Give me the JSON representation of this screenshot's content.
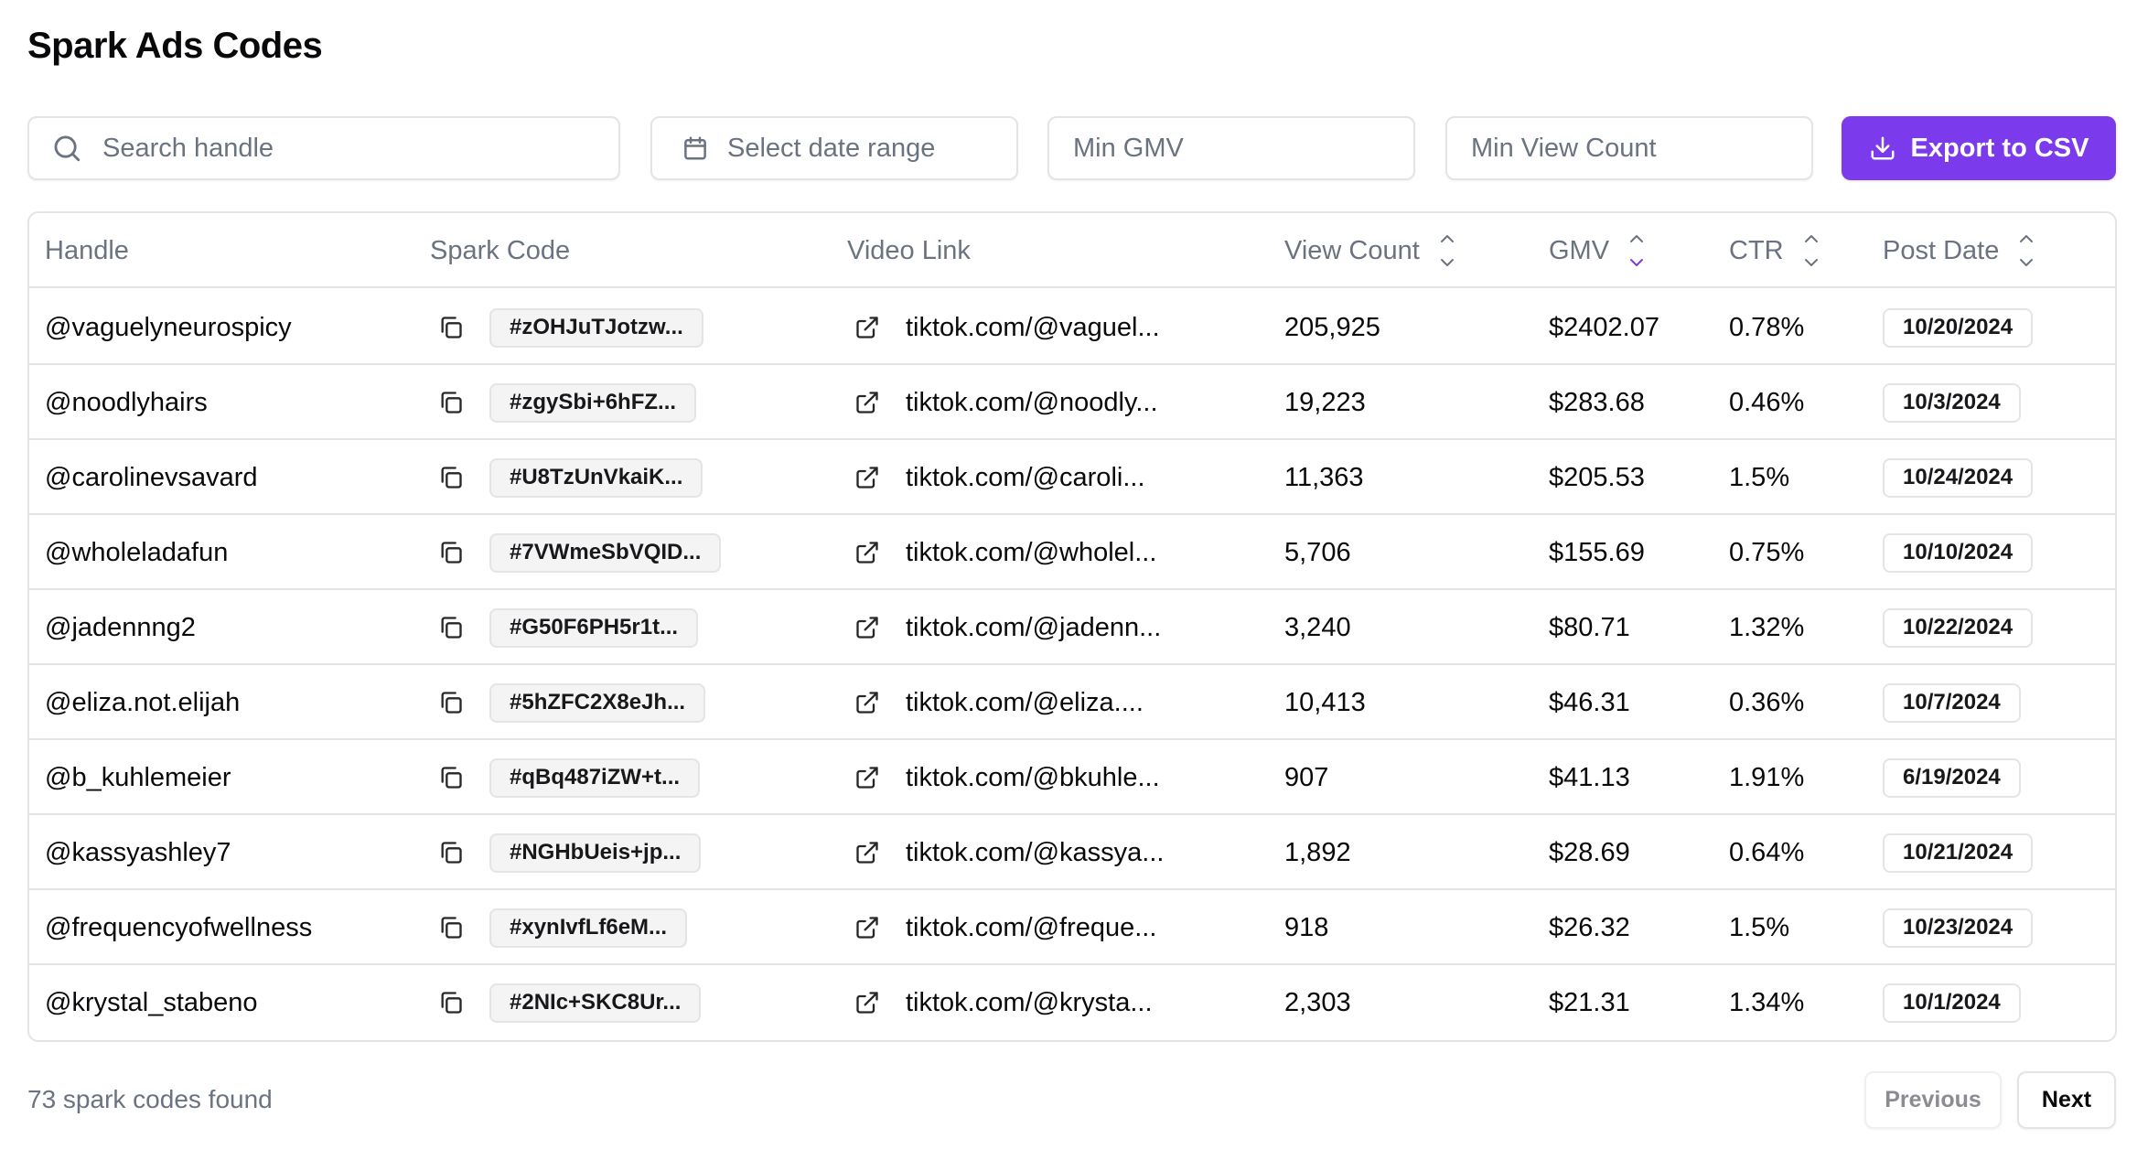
{
  "page": {
    "title": "Spark Ads Codes"
  },
  "filters": {
    "search_placeholder": "Search handle",
    "search_icon": "search-icon",
    "date_placeholder": "Select date range",
    "date_icon": "calendar-icon",
    "min_gmv_placeholder": "Min GMV",
    "min_view_placeholder": "Min View Count",
    "export_label": "Export to CSV",
    "export_icon": "download-icon"
  },
  "colors": {
    "accent": "#7c3aed",
    "border": "#e4e4e7",
    "muted_text": "#6b7280",
    "text": "#09090b",
    "chip_bg": "#f4f4f5"
  },
  "table": {
    "columns": [
      {
        "label": "Handle",
        "sortable": false
      },
      {
        "label": "Spark Code",
        "sortable": false
      },
      {
        "label": "Video Link",
        "sortable": false
      },
      {
        "label": "View Count",
        "sortable": true,
        "sort": "none"
      },
      {
        "label": "GMV",
        "sortable": true,
        "sort": "desc"
      },
      {
        "label": "CTR",
        "sortable": true,
        "sort": "none"
      },
      {
        "label": "Post Date",
        "sortable": true,
        "sort": "none"
      }
    ],
    "rows": [
      {
        "handle": "@vaguelyneurospicy",
        "spark_code": "#zOHJuTJotzw...",
        "video_link": "tiktok.com/@vaguel...",
        "views": "205,925",
        "gmv": "$2402.07",
        "ctr": "0.78%",
        "post_date": "10/20/2024"
      },
      {
        "handle": "@noodlyhairs",
        "spark_code": "#zgySbi+6hFZ...",
        "video_link": "tiktok.com/@noodly...",
        "views": "19,223",
        "gmv": "$283.68",
        "ctr": "0.46%",
        "post_date": "10/3/2024"
      },
      {
        "handle": "@carolinevsavard",
        "spark_code": "#U8TzUnVkaiK...",
        "video_link": "tiktok.com/@caroli...",
        "views": "11,363",
        "gmv": "$205.53",
        "ctr": "1.5%",
        "post_date": "10/24/2024"
      },
      {
        "handle": "@wholeladafun",
        "spark_code": "#7VWmeSbVQID...",
        "video_link": "tiktok.com/@wholel...",
        "views": "5,706",
        "gmv": "$155.69",
        "ctr": "0.75%",
        "post_date": "10/10/2024"
      },
      {
        "handle": "@jadennng2",
        "spark_code": "#G50F6PH5r1t...",
        "video_link": "tiktok.com/@jadenn...",
        "views": "3,240",
        "gmv": "$80.71",
        "ctr": "1.32%",
        "post_date": "10/22/2024"
      },
      {
        "handle": "@eliza.not.elijah",
        "spark_code": "#5hZFC2X8eJh...",
        "video_link": "tiktok.com/@eliza....",
        "views": "10,413",
        "gmv": "$46.31",
        "ctr": "0.36%",
        "post_date": "10/7/2024"
      },
      {
        "handle": "@b_kuhlemeier",
        "spark_code": "#qBq487iZW+t...",
        "video_link": "tiktok.com/@bkuhle...",
        "views": "907",
        "gmv": "$41.13",
        "ctr": "1.91%",
        "post_date": "6/19/2024"
      },
      {
        "handle": "@kassyashley7",
        "spark_code": "#NGHbUeis+jp...",
        "video_link": "tiktok.com/@kassya...",
        "views": "1,892",
        "gmv": "$28.69",
        "ctr": "0.64%",
        "post_date": "10/21/2024"
      },
      {
        "handle": "@frequencyofwellness",
        "spark_code": "#xynIvfLf6eM...",
        "video_link": "tiktok.com/@freque...",
        "views": "918",
        "gmv": "$26.32",
        "ctr": "1.5%",
        "post_date": "10/23/2024"
      },
      {
        "handle": "@krystal_stabeno",
        "spark_code": "#2NIc+SKC8Ur...",
        "video_link": "tiktok.com/@krysta...",
        "views": "2,303",
        "gmv": "$21.31",
        "ctr": "1.34%",
        "post_date": "10/1/2024"
      }
    ]
  },
  "footer": {
    "count_text": "73 spark codes found",
    "previous_label": "Previous",
    "previous_disabled": true,
    "next_label": "Next"
  }
}
